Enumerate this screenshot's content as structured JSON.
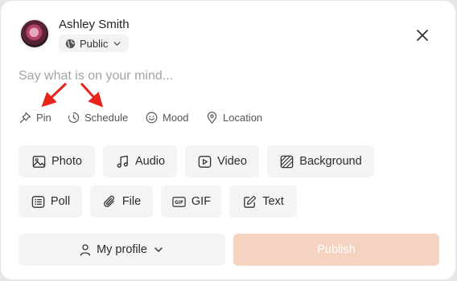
{
  "user": {
    "name": "Ashley Smith",
    "visibility": "Public"
  },
  "composer": {
    "placeholder": "Say what is on your mind..."
  },
  "options": [
    {
      "label": "Pin",
      "icon": "pin-icon"
    },
    {
      "label": "Schedule",
      "icon": "clock-icon"
    },
    {
      "label": "Mood",
      "icon": "smiley-icon"
    },
    {
      "label": "Location",
      "icon": "location-pin-icon"
    }
  ],
  "attachments": [
    {
      "label": "Photo",
      "icon": "image-icon"
    },
    {
      "label": "Audio",
      "icon": "music-note-icon"
    },
    {
      "label": "Video",
      "icon": "video-play-icon"
    },
    {
      "label": "Background",
      "icon": "hatched-square-icon"
    },
    {
      "label": "Poll",
      "icon": "list-icon"
    },
    {
      "label": "File",
      "icon": "paperclip-icon"
    },
    {
      "label": "GIF",
      "icon": "gif-icon"
    },
    {
      "label": "Text",
      "icon": "pencil-square-icon"
    }
  ],
  "footer": {
    "profile_label": "My profile",
    "publish_label": "Publish"
  },
  "colors": {
    "publish_disabled": "#f4d3c0",
    "annotation_arrow": "#e8231b",
    "chip_bg": "#f4f4f4"
  }
}
